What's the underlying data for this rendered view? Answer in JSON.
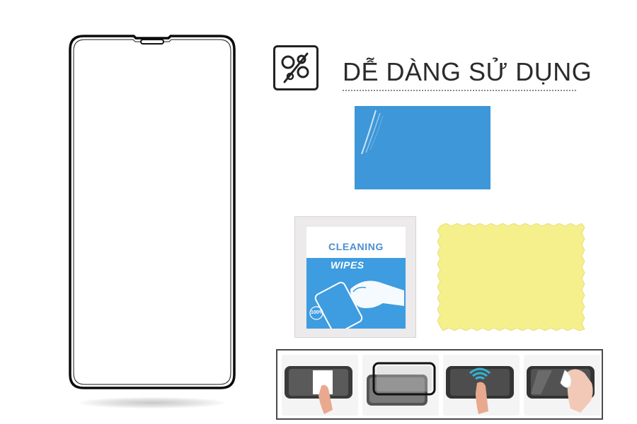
{
  "heading": {
    "text": "DỄ DÀNG SỬ DỤNG",
    "icon": "no-bubbles-icon"
  },
  "items": {
    "glass": {
      "name": "tempered-glass-screen-protector"
    },
    "sticker": {
      "name": "dust-removal-sticker",
      "color": "#3d97d8"
    },
    "wipes": {
      "title": "CLEANING",
      "subtitle": "WIPES",
      "badge": "100%"
    },
    "cloth": {
      "name": "microfiber-cloth",
      "color": "#f5ef8c"
    }
  },
  "steps": [
    {
      "name": "step-remove-dust"
    },
    {
      "name": "step-place-glass"
    },
    {
      "name": "step-press-center"
    },
    {
      "name": "step-wipe-bubbles"
    }
  ]
}
